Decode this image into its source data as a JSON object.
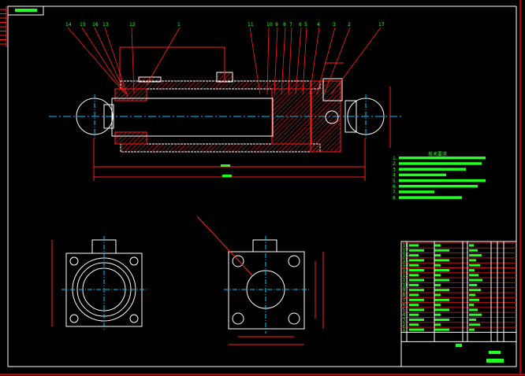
{
  "colors": {
    "background": "#000000",
    "outline": "#ffffff",
    "section": "#ff1a1a",
    "text": "#22ff22",
    "centerline": "#00c8ff"
  },
  "main_view": {
    "balloons_left": [
      "14",
      "15",
      "16",
      "13",
      "12",
      "1"
    ],
    "balloons_right": [
      "11",
      "10",
      "9",
      "8",
      "7",
      "6",
      "5",
      "4",
      "3",
      "2",
      "17"
    ]
  },
  "notes": {
    "heading": "技术要求",
    "items": [
      "1.",
      "2.",
      "3.",
      "4.",
      "5.",
      "6.",
      "7.",
      "8."
    ]
  },
  "parts_list": {
    "row_numbers": [
      "18",
      "17",
      "16",
      "15",
      "14",
      "13",
      "12",
      "11",
      "10",
      "9",
      "8",
      "7",
      "6",
      "5",
      "4",
      "3",
      "2",
      "1"
    ]
  }
}
